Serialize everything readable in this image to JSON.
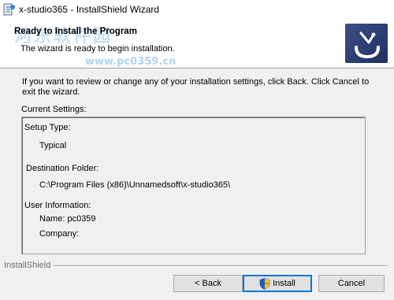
{
  "window": {
    "title": "x-studio365 - InstallShield Wizard"
  },
  "header": {
    "title": "Ready to Install the Program",
    "subtitle": "The wizard is ready to begin installation.",
    "watermark_text": "河东软件园",
    "watermark_url": "www.pc0359.cn"
  },
  "body": {
    "intro": "If you want to review or change any of your installation settings, click Back. Click Cancel to exit the wizard.",
    "current_settings_label": "Current Settings:",
    "settings": {
      "setup_type_label": "Setup Type:",
      "setup_type_value": "Typical",
      "destination_label": "Destination Folder:",
      "destination_value": "C:\\Program Files (x86)\\Unnamedsoft\\x-studio365\\",
      "user_info_label": "User Information:",
      "name_line": "Name: pc0359",
      "company_line": "Company:"
    }
  },
  "footer": {
    "brand": "InstallShield"
  },
  "buttons": {
    "back": "< Back",
    "install": "Install",
    "cancel": "Cancel"
  },
  "colors": {
    "logo_bg": "#2c3d74",
    "focus_border": "#0078d7",
    "watermark": "#96c3eb"
  }
}
